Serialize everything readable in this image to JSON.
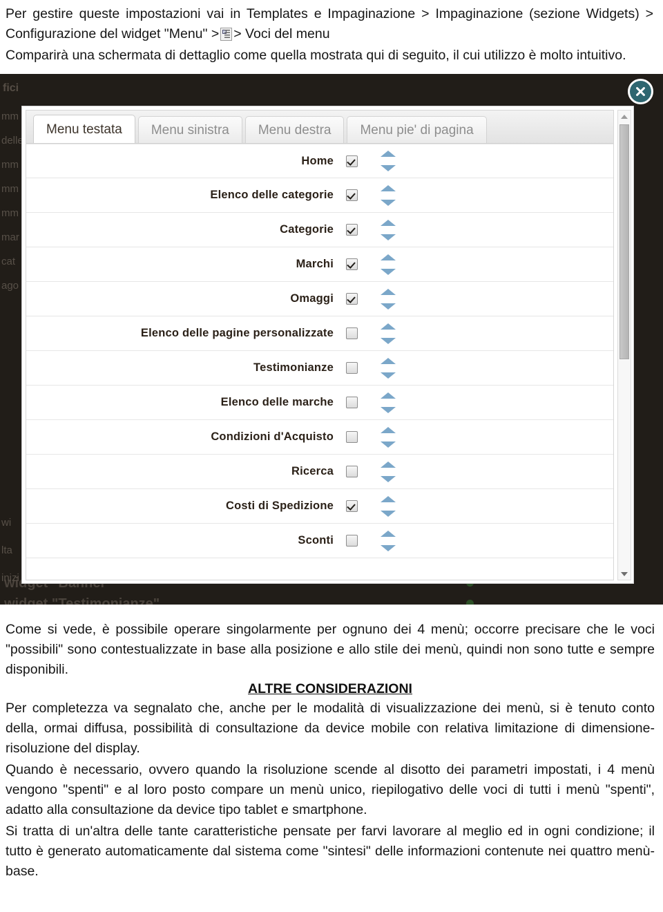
{
  "document": {
    "intro_paragraphs": [
      "Per gestire queste impostazioni vai in Templates e Impaginazione > Impaginazione (sezione Widgets) > Configurazione del widget \"Menu\" >",
      "> Voci del menu",
      "Comparirà una schermata di dettaglio come quella mostrata qui di seguito, il cui utilizzo è molto intuitivo."
    ],
    "after_paragraph": "Come si vede, è possibile operare singolarmente per ognuno dei 4 menù; occorre precisare che le voci \"possibili\" sono contestualizzate in base alla posizione e allo stile dei menù, quindi non sono tutte e sempre disponibili.",
    "section_heading": "ALTRE CONSIDERAZIONI",
    "closing_paragraphs": [
      "Per completezza va segnalato che, anche per le modalità di visualizzazione dei menù, si è tenuto conto della, ormai diffusa, possibilità di consultazione da device mobile con relativa limitazione di dimensione-risoluzione del display.",
      "Quando è necessario, ovvero quando la risoluzione scende al disotto dei parametri impostati, i 4 menù vengono \"spenti\" e al loro posto compare un menù unico, riepilogativo delle voci di tutti i menù \"spenti\", adatto alla consultazione da device tipo tablet e smartphone.",
      "Si tratta di un'altra delle tante caratteristiche pensate per farvi lavorare al meglio ed in ogni condizione; il tutto è generato automaticamente dal sistema come \"sintesi\" delle informazioni contenute nei quattro menù-base."
    ]
  },
  "screenshot": {
    "overlay_color": "#211d18",
    "accent_color": "#2e6670",
    "arrow_color": "#7ba7c9",
    "background_page": {
      "header_fragment": "fici",
      "sidebar_fragments": [
        "mm",
        "delle",
        "mm",
        "mm",
        "mm",
        "mar",
        "cat",
        "ago"
      ],
      "lower_fragments": [
        "wi",
        "lta",
        "inizi"
      ],
      "widget_rows": [
        "widget \"Banner\"",
        "widget \"Testimonianze\""
      ]
    },
    "dialog": {
      "close_label": "Chiudi",
      "tabs": [
        {
          "label": "Menu testata",
          "active": true
        },
        {
          "label": "Menu sinistra",
          "active": false
        },
        {
          "label": "Menu destra",
          "active": false
        },
        {
          "label": "Menu pie' di pagina",
          "active": false
        }
      ],
      "menu_items": [
        {
          "label": "Home",
          "checked": true
        },
        {
          "label": "Elenco delle categorie",
          "checked": true
        },
        {
          "label": "Categorie",
          "checked": true
        },
        {
          "label": "Marchi",
          "checked": true
        },
        {
          "label": "Omaggi",
          "checked": true
        },
        {
          "label": "Elenco delle pagine personalizzate",
          "checked": false
        },
        {
          "label": "Testimonianze",
          "checked": false
        },
        {
          "label": "Elenco delle marche",
          "checked": false
        },
        {
          "label": "Condizioni d'Acquisto",
          "checked": false
        },
        {
          "label": "Ricerca",
          "checked": false
        },
        {
          "label": "Costi di Spedizione",
          "checked": true
        },
        {
          "label": "Sconti",
          "checked": false
        }
      ]
    }
  }
}
